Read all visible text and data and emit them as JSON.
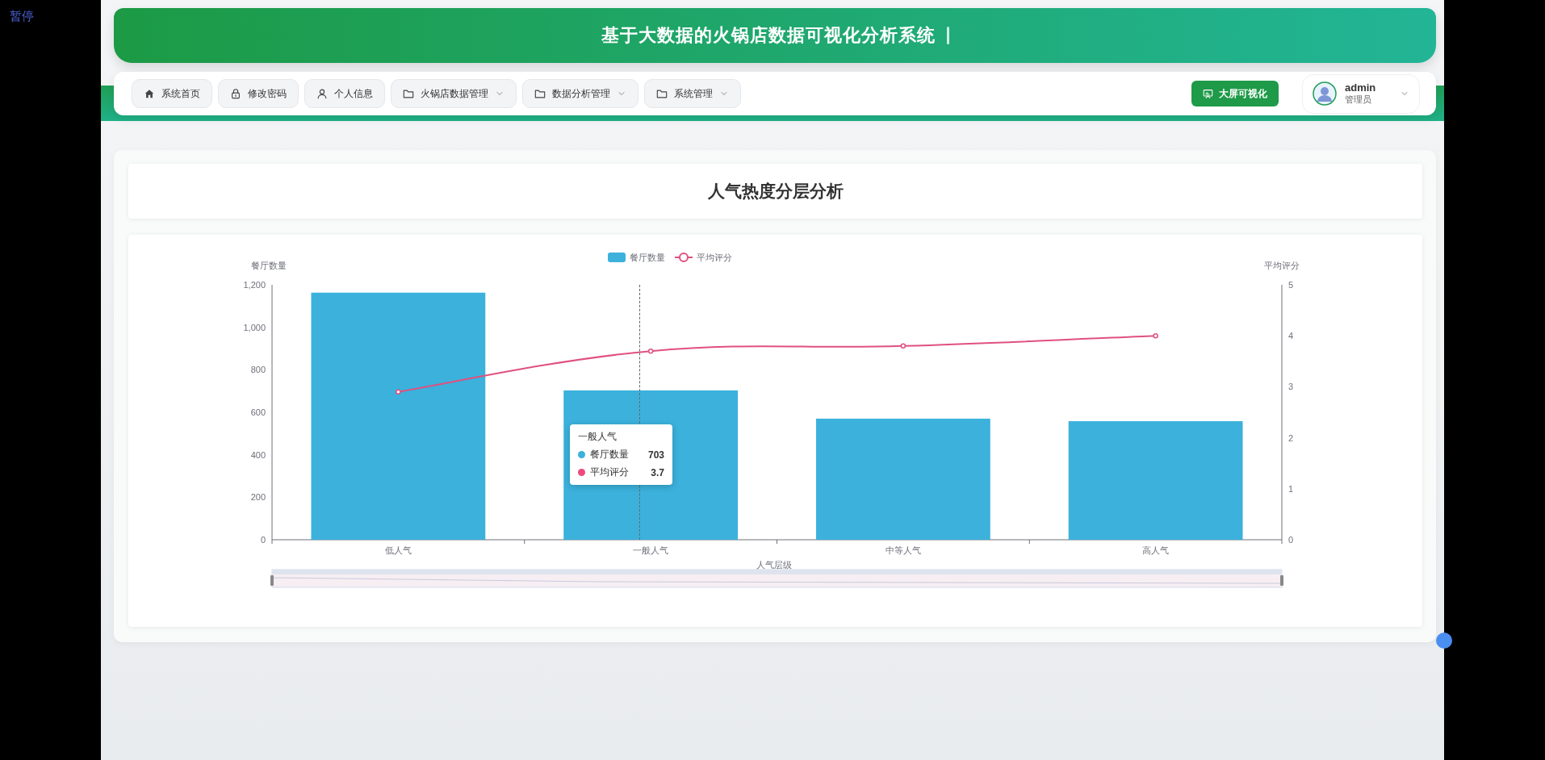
{
  "overlay_label": "暂停",
  "header": {
    "title": "基于大数据的火锅店数据可视化分析系统",
    "typing_cursor": true
  },
  "nav": {
    "items": [
      {
        "label": "系统首页",
        "has_menu": false
      },
      {
        "label": "修改密码",
        "has_menu": false
      },
      {
        "label": "个人信息",
        "has_menu": false
      },
      {
        "label": "火锅店数据管理",
        "has_menu": true
      },
      {
        "label": "数据分析管理",
        "has_menu": true
      },
      {
        "label": "系统管理",
        "has_menu": true
      }
    ],
    "screen_button": "大屏可视化",
    "user": {
      "name": "admin",
      "role": "管理员"
    }
  },
  "page": {
    "title": "人气热度分层分析",
    "bar_chart": {
      "chart_data": {
        "type": "bar",
        "xlabel": "人气层级",
        "ylabel": "餐厅数量",
        "legend": "top",
        "categories": [
          "低人气",
          "一般人气",
          "中等人气",
          "高人气"
        ],
        "series": [
          {
            "name": "餐厅数量",
            "color": "#3bb1dc",
            "values": [
              1163,
              703,
              570,
              558
            ]
          }
        ],
        "ylim": [
          0,
          1200
        ],
        "yticks": [
          {
            "value": 0,
            "label": "0"
          },
          {
            "value": 200,
            "label": "200"
          },
          {
            "value": 400,
            "label": "400"
          },
          {
            "value": 600,
            "label": "600"
          },
          {
            "value": 800,
            "label": "800"
          },
          {
            "value": 1000,
            "label": "1,000"
          },
          {
            "value": 1200,
            "label": "1,200"
          }
        ]
      }
    },
    "line_chart": {
      "chart_data": {
        "type": "line",
        "ylabel": "平均评分",
        "legend": "top",
        "series": [
          {
            "name": "平均评分",
            "color": "#e0517f",
            "marker": true,
            "values": [
              2.9,
              3.7,
              3.8,
              4.0
            ]
          }
        ],
        "ylim": [
          0,
          5
        ],
        "yticks": [
          0,
          1,
          2,
          3,
          4,
          5
        ]
      }
    },
    "tooltip": {
      "title": "一般人气",
      "rows": [
        {
          "name": "餐厅数量",
          "value": "703",
          "color": "#3bb1dc"
        },
        {
          "name": "平均评分",
          "value": "3.7",
          "color": "#ee4a7c"
        }
      ]
    }
  }
}
